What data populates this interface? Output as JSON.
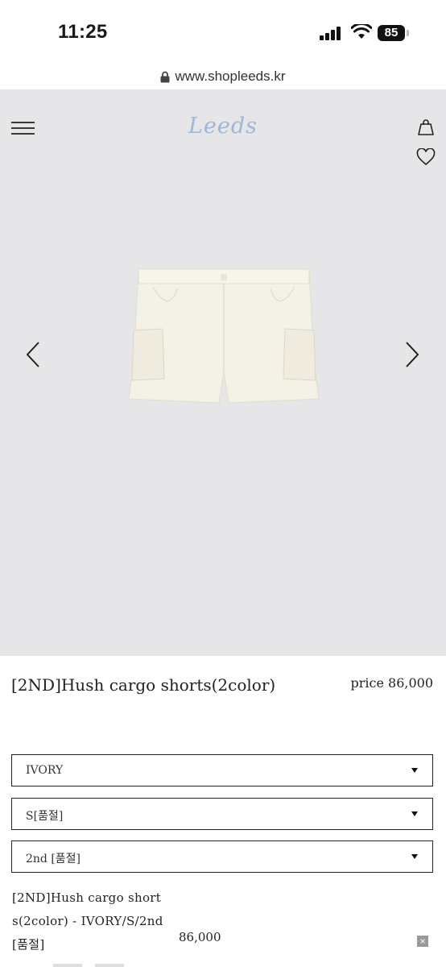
{
  "status_bar": {
    "time": "11:25",
    "battery": "85"
  },
  "browser": {
    "url": "www.shopleeds.kr"
  },
  "header": {
    "logo": "Leeds"
  },
  "product": {
    "title": "[2ND]Hush cargo shorts(2color)",
    "price_label": "price",
    "price": "86,000"
  },
  "options": [
    {
      "value": "IVORY"
    },
    {
      "value": "S[품절]"
    },
    {
      "value": "2nd [품절]"
    }
  ],
  "selection": {
    "summary": "[2ND]Hush cargo shorts(2color) - IVORY/S/2nd [품절]",
    "price": "86,000",
    "remove_label": "×"
  },
  "colors": {
    "hero_bg": "#e6e6e8",
    "logo": "#9fb6d6",
    "border": "#222222"
  }
}
